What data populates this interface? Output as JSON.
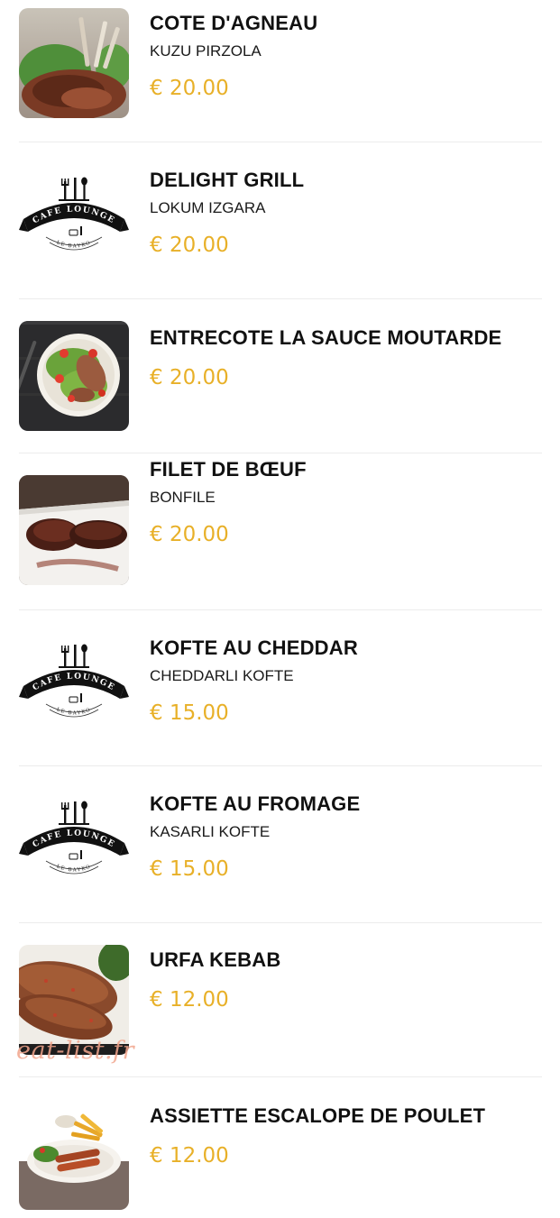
{
  "colors": {
    "price": "#e8b028",
    "name": "#111111",
    "divider": "#ececec",
    "watermark": "#f2a58c"
  },
  "logo": {
    "line1": "CAFE LOUNGE",
    "line2": "LE BAYKO"
  },
  "watermark": "eat-list.fr",
  "items": [
    {
      "name": "COTE D'AGNEAU",
      "subtitle": "KUZU PIRZOLA",
      "price": "€ 20.00",
      "image": "lamb-chops-photo"
    },
    {
      "name": "DELIGHT GRILL",
      "subtitle": "LOKUM IZGARA",
      "price": "€ 20.00",
      "image": "cafe-lounge-logo"
    },
    {
      "name": "ENTRECOTE LA SAUCE MOUTARDE",
      "subtitle": "",
      "price": "€ 20.00",
      "image": "steak-salad-photo"
    },
    {
      "name": "FILET DE BŒUF",
      "subtitle": "BONFILE",
      "price": "€ 20.00",
      "image": "beef-fillet-photo"
    },
    {
      "name": "KOFTE AU CHEDDAR",
      "subtitle": "CHEDDARLI KOFTE",
      "price": "€ 15.00",
      "image": "cafe-lounge-logo"
    },
    {
      "name": "KOFTE AU FROMAGE",
      "subtitle": "KASARLI KOFTE",
      "price": "€ 15.00",
      "image": "cafe-lounge-logo"
    },
    {
      "name": "URFA KEBAB",
      "subtitle": "",
      "price": "€ 12.00",
      "image": "kebab-photo"
    },
    {
      "name": "ASSIETTE ESCALOPE DE POULET",
      "subtitle": "",
      "price": "€ 12.00",
      "image": "chicken-plate-photo"
    }
  ]
}
